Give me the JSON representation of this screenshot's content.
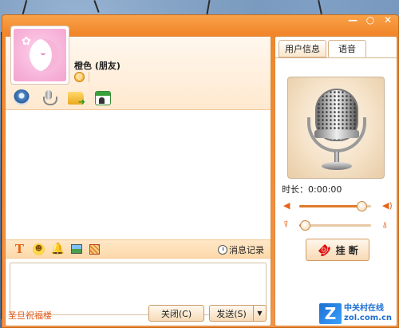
{
  "window": {
    "controls": [
      "—",
      "○",
      "✕"
    ]
  },
  "contact": {
    "name": "橙色 (朋友)"
  },
  "format_bar": {
    "history_label": "消息记录"
  },
  "bottom": {
    "greeting": "圣旦祝福楼",
    "close_label": "关闭(C)",
    "send_label": "发送(S)",
    "send_dropdown": "▼"
  },
  "right_panel": {
    "tabs": [
      "用户信息",
      "语音"
    ],
    "active_tab": "语音",
    "duration_label": "时长：",
    "duration_value": "0:00:00",
    "speaker_volume": 0.87,
    "mic_volume": 0.08,
    "hangup_label": "挂 断"
  },
  "watermark": {
    "logo": "Z",
    "text_cn": "中关村在线",
    "text_en": "zol.com.cn"
  },
  "colors": {
    "accent": "#f2862a",
    "text_link": "#e45a1a"
  }
}
